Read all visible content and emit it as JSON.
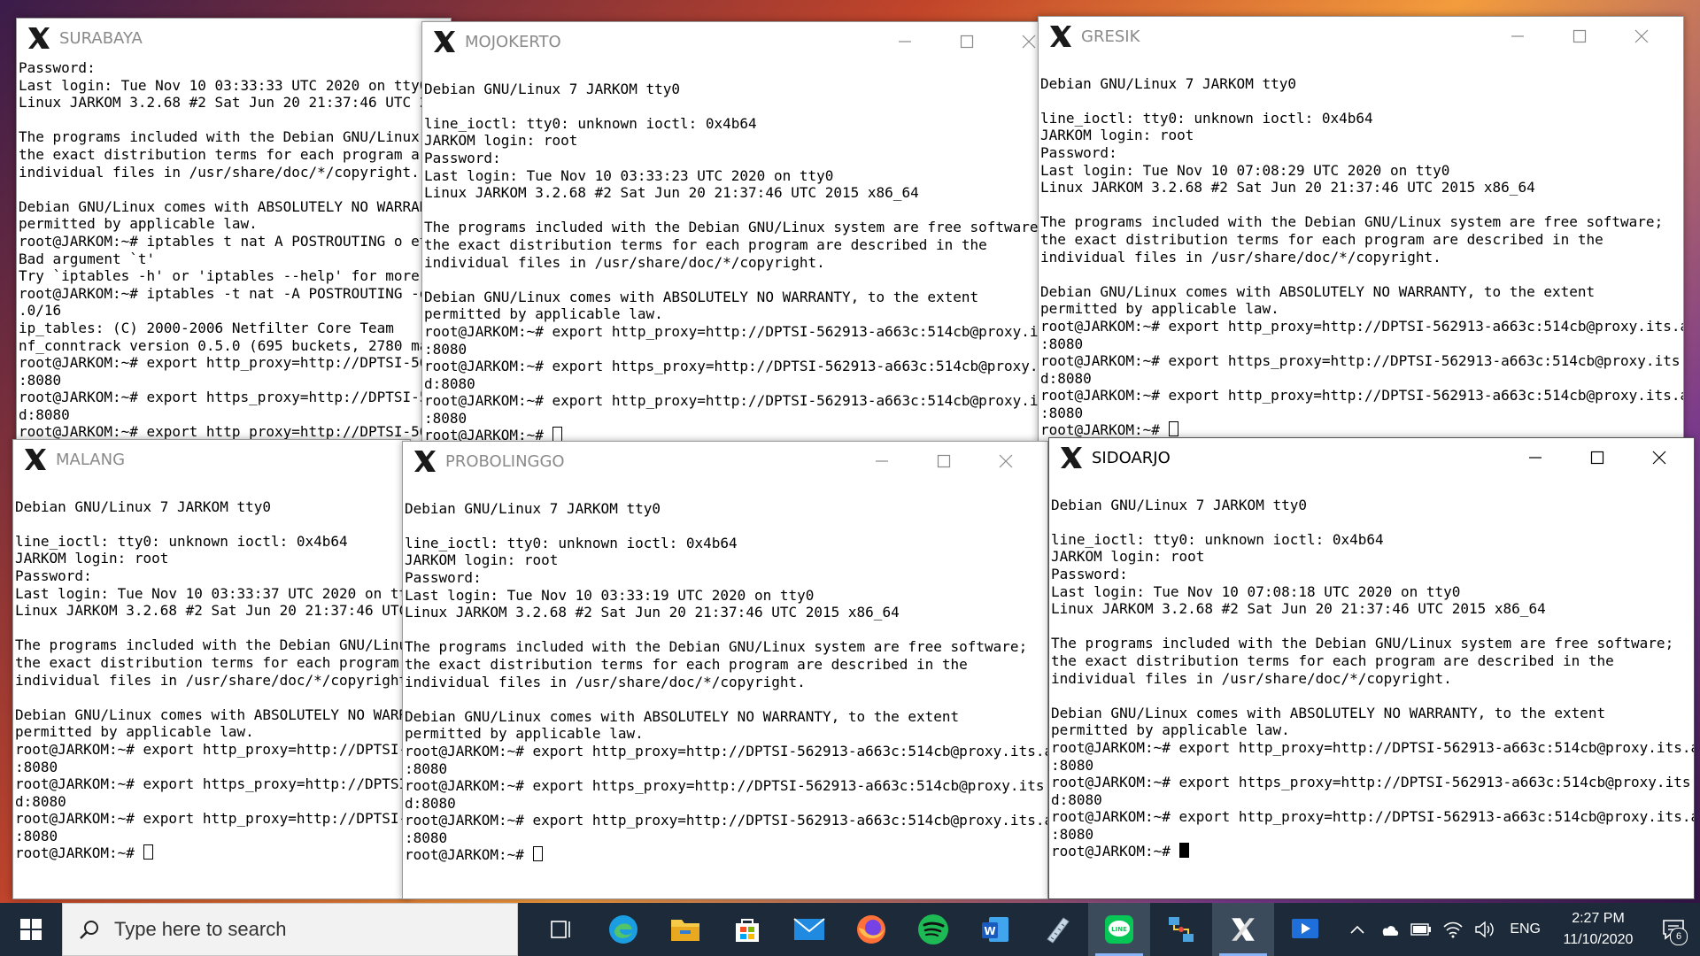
{
  "windows": {
    "surabaya": {
      "title": "SURABAYA",
      "lines": [
        "Password:",
        "Last login: Tue Nov 10 03:33:33 UTC 2020 on tty0",
        "Linux JARKOM 3.2.68 #2 Sat Jun 20 21:37:46 UTC 2015",
        "",
        "The programs included with the Debian GNU/Linux sys",
        "the exact distribution terms for each program are d",
        "individual files in /usr/share/doc/*/copyright.",
        "",
        "Debian GNU/Linux comes with ABSOLUTELY NO WARRANTY,",
        "permitted by applicable law.",
        "root@JARKOM:~# iptables t nat A POSTROUTING o eth0",
        "Bad argument `t'",
        "Try `iptables -h' or 'iptables --help' for more inf",
        "root@JARKOM:~# iptables -t nat -A POSTROUTING -o et",
        ".0/16",
        "ip_tables: (C) 2000-2006 Netfilter Core Team",
        "nf_conntrack version 0.5.0 (695 buckets, 2780 max)",
        "root@JARKOM:~# export http_proxy=http://DPTSI-56291",
        ":8080",
        "root@JARKOM:~# export https_proxy=http://DPTSI-5629",
        "d:8080",
        "root@JARKOM:~# export http_proxy=http://DPTSI-56291"
      ]
    },
    "mojokerto": {
      "title": "MOJOKERTO",
      "lines": [
        "",
        "Debian GNU/Linux 7 JARKOM tty0",
        "",
        "line_ioctl: tty0: unknown ioctl: 0x4b64",
        "JARKOM login: root",
        "Password:",
        "Last login: Tue Nov 10 03:33:23 UTC 2020 on tty0",
        "Linux JARKOM 3.2.68 #2 Sat Jun 20 21:37:46 UTC 2015 x86_64",
        "",
        "The programs included with the Debian GNU/Linux system are free software;",
        "the exact distribution terms for each program are described in the",
        "individual files in /usr/share/doc/*/copyright.",
        "",
        "Debian GNU/Linux comes with ABSOLUTELY NO WARRANTY, to the extent",
        "permitted by applicable law.",
        "root@JARKOM:~# export http_proxy=http://DPTSI-562913-a663c:514cb@proxy.its.ac",
        ":8080",
        "root@JARKOM:~# export https_proxy=http://DPTSI-562913-a663c:514cb@proxy.its.a",
        "d:8080",
        "root@JARKOM:~# export http_proxy=http://DPTSI-562913-a663c:514cb@proxy.its.ac",
        ":8080",
        "root@JARKOM:~# "
      ]
    },
    "gresik": {
      "title": "GRESIK",
      "lines": [
        "",
        "Debian GNU/Linux 7 JARKOM tty0",
        "",
        "line_ioctl: tty0: unknown ioctl: 0x4b64",
        "JARKOM login: root",
        "Password:",
        "Last login: Tue Nov 10 07:08:29 UTC 2020 on tty0",
        "Linux JARKOM 3.2.68 #2 Sat Jun 20 21:37:46 UTC 2015 x86_64",
        "",
        "The programs included with the Debian GNU/Linux system are free software;",
        "the exact distribution terms for each program are described in the",
        "individual files in /usr/share/doc/*/copyright.",
        "",
        "Debian GNU/Linux comes with ABSOLUTELY NO WARRANTY, to the extent",
        "permitted by applicable law.",
        "root@JARKOM:~# export http_proxy=http://DPTSI-562913-a663c:514cb@proxy.its.ac.id",
        ":8080",
        "root@JARKOM:~# export https_proxy=http://DPTSI-562913-a663c:514cb@proxy.its.ac.i",
        "d:8080",
        "root@JARKOM:~# export http_proxy=http://DPTSI-562913-a663c:514cb@proxy.its.ac.id",
        ":8080",
        "root@JARKOM:~# "
      ]
    },
    "malang": {
      "title": "MALANG",
      "lines": [
        "",
        "Debian GNU/Linux 7 JARKOM tty0",
        "",
        "line_ioctl: tty0: unknown ioctl: 0x4b64",
        "JARKOM login: root",
        "Password:",
        "Last login: Tue Nov 10 03:33:37 UTC 2020 on tty0",
        "Linux JARKOM 3.2.68 #2 Sat Jun 20 21:37:46 UTC 20",
        "",
        "The programs included with the Debian GNU/Linux s",
        "the exact distribution terms for each program are",
        "individual files in /usr/share/doc/*/copyright.",
        "",
        "Debian GNU/Linux comes with ABSOLUTELY NO WARRANT",
        "permitted by applicable law.",
        "root@JARKOM:~# export http_proxy=http://DPTSI-562",
        ":8080",
        "root@JARKOM:~# export https_proxy=http://DPTSI-56",
        "d:8080",
        "root@JARKOM:~# export http_proxy=http://DPTSI-562",
        ":8080",
        "root@JARKOM:~# "
      ]
    },
    "probolinggo": {
      "title": "PROBOLINGGO",
      "lines": [
        "",
        "Debian GNU/Linux 7 JARKOM tty0",
        "",
        "line_ioctl: tty0: unknown ioctl: 0x4b64",
        "JARKOM login: root",
        "Password:",
        "Last login: Tue Nov 10 03:33:19 UTC 2020 on tty0",
        "Linux JARKOM 3.2.68 #2 Sat Jun 20 21:37:46 UTC 2015 x86_64",
        "",
        "The programs included with the Debian GNU/Linux system are free software;",
        "the exact distribution terms for each program are described in the",
        "individual files in /usr/share/doc/*/copyright.",
        "",
        "Debian GNU/Linux comes with ABSOLUTELY NO WARRANTY, to the extent",
        "permitted by applicable law.",
        "root@JARKOM:~# export http_proxy=http://DPTSI-562913-a663c:514cb@proxy.its.ac.id",
        ":8080",
        "root@JARKOM:~# export https_proxy=http://DPTSI-562913-a663c:514cb@proxy.its.ac.i",
        "d:8080",
        "root@JARKOM:~# export http_proxy=http://DPTSI-562913-a663c:514cb@proxy.its.ac.id",
        ":8080",
        "root@JARKOM:~# "
      ]
    },
    "sidoarjo": {
      "title": "SIDOARJO",
      "lines": [
        "",
        "Debian GNU/Linux 7 JARKOM tty0",
        "",
        "line_ioctl: tty0: unknown ioctl: 0x4b64",
        "JARKOM login: root",
        "Password:",
        "Last login: Tue Nov 10 07:08:18 UTC 2020 on tty0",
        "Linux JARKOM 3.2.68 #2 Sat Jun 20 21:37:46 UTC 2015 x86_64",
        "",
        "The programs included with the Debian GNU/Linux system are free software;",
        "the exact distribution terms for each program are described in the",
        "individual files in /usr/share/doc/*/copyright.",
        "",
        "Debian GNU/Linux comes with ABSOLUTELY NO WARRANTY, to the extent",
        "permitted by applicable law.",
        "root@JARKOM:~# export http_proxy=http://DPTSI-562913-a663c:514cb@proxy.its.ac.id",
        ":8080",
        "root@JARKOM:~# export https_proxy=http://DPTSI-562913-a663c:514cb@proxy.its.ac.i",
        "d:8080",
        "root@JARKOM:~# export http_proxy=http://DPTSI-562913-a663c:514cb@proxy.its.ac.id",
        ":8080",
        "root@JARKOM:~# "
      ]
    }
  },
  "taskbar": {
    "search_placeholder": "Type here to search",
    "apps": [
      "task-view-icon",
      "edge-icon",
      "file-explorer-icon",
      "store-icon",
      "mail-icon",
      "firefox-icon",
      "spotify-icon",
      "word-icon",
      "ruler-icon",
      "line-icon",
      "network-app-icon",
      "xming-icon",
      "video-icon"
    ],
    "language": "ENG",
    "time": "2:27 PM",
    "date": "11/10/2020",
    "notification_count": "6"
  },
  "colors": {
    "accent": "#8ab4f8",
    "taskbar": "#1c2a39"
  }
}
